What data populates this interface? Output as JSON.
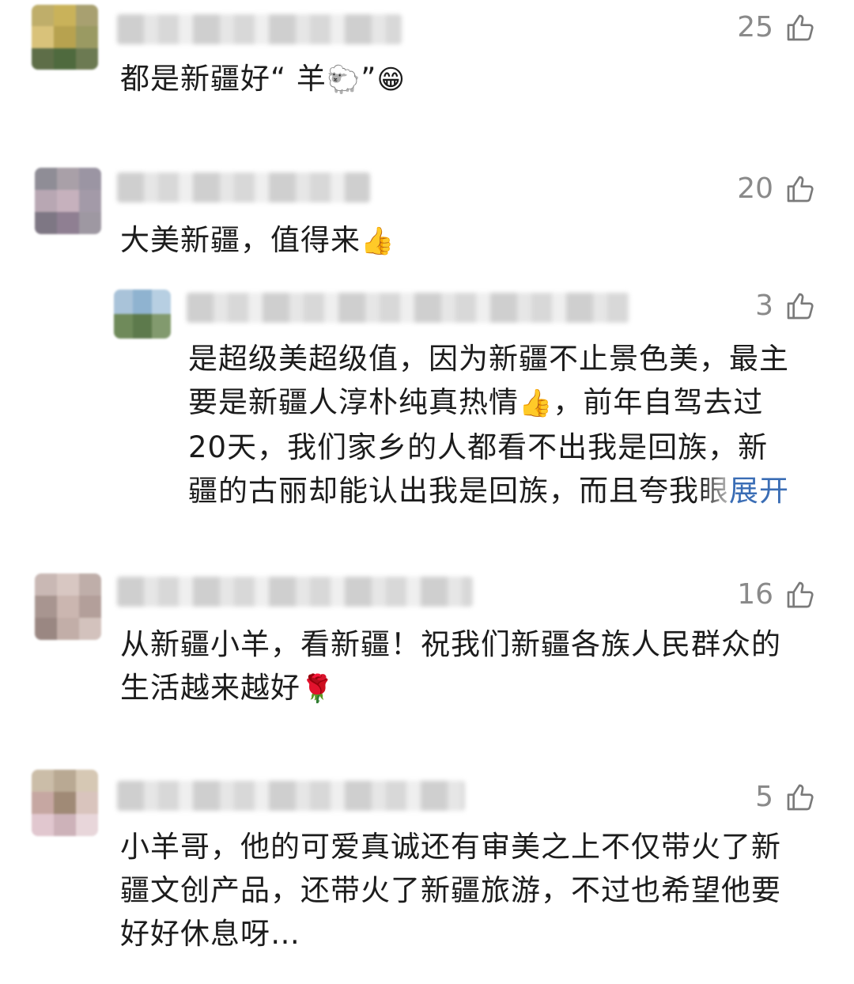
{
  "comments": [
    {
      "likes": "25",
      "text": "都是新疆好“ 羊",
      "text_tail": "”",
      "emojis": [
        "🐑",
        "😁"
      ]
    },
    {
      "likes": "20",
      "text": "大美新疆，值得来",
      "emojis": [
        "👍"
      ]
    },
    {
      "likes": "3",
      "lines": [
        "是超级美超级值，因为新疆不止景色美，最主",
        "要是新疆人淳朴纯真热情",
        "，前年自驾去过",
        "20天，我们家乡的人都看不出我是回族，新",
        "疆的古丽却能认出我是回族，而且夸我",
        "眼"
      ],
      "emojis": [
        "👍"
      ],
      "expand_label": "展开"
    },
    {
      "likes": "16",
      "lines": [
        "从新疆小羊，看新疆！祝我们新疆各族人民群众的",
        "生活越来越好"
      ],
      "emojis": [
        "🌹"
      ]
    },
    {
      "likes": "5",
      "lines": [
        "小羊哥，他的可爱真诚还有审美之上不仅带火了新",
        "疆文创产品，还带火了新疆旅游，不过也希望他要",
        "好好休息呀…"
      ]
    }
  ],
  "icons": {
    "like": "thumbs-up-outline-icon"
  },
  "colors": {
    "text": "#1c1c1c",
    "meta": "#8a8a8a",
    "link": "#3a6db5"
  }
}
